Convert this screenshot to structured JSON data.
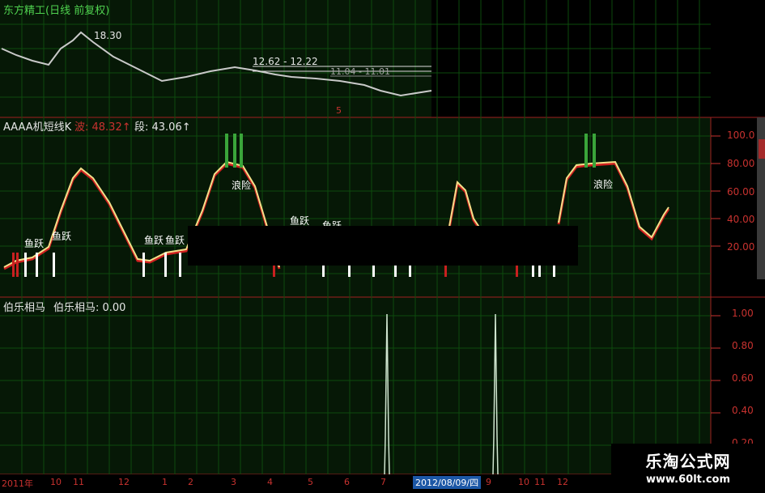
{
  "top_panel": {
    "title": "东方精工(日线 前复权)",
    "price_high": "18.30",
    "range_a": "12.62 - 12.22",
    "range_b": "11.04 - 11.01",
    "marker": "5"
  },
  "mid_panel": {
    "indicator_name": "AAAA机短线K",
    "wave_label": "波: 48.32↑",
    "segment_label": "段: 43.06↑",
    "y_ticks": [
      "100.0",
      "80.00",
      "60.00",
      "40.00",
      "20.00"
    ],
    "annotations": [
      "鱼跃",
      "鱼跃",
      "鱼跃",
      "鱼跃",
      "浪险",
      "鱼跃",
      "鱼跃",
      "浪险"
    ]
  },
  "bottom_panel": {
    "indicator_name": "伯乐相马",
    "value_label": "伯乐相马: 0.00",
    "y_ticks": [
      "1.00",
      "0.80",
      "0.60",
      "0.40",
      "0.20"
    ]
  },
  "date_axis": {
    "labels": [
      "2011年",
      "10",
      "11",
      "12",
      "1",
      "2",
      "3",
      "4",
      "5",
      "6",
      "7",
      "8",
      "9",
      "10",
      "11",
      "12"
    ],
    "highlight": "2012/08/09/四"
  },
  "watermark": {
    "title": "乐淘公式网",
    "url": "www.60lt.com"
  },
  "colors": {
    "grid": "#0d4a0d",
    "panel_bg": "#061806",
    "line_red": "#d02020",
    "line_yellow": "#f2e08a",
    "text_red": "#c8322f",
    "text_green": "#4fd14f",
    "text_white": "#ffffff"
  }
}
